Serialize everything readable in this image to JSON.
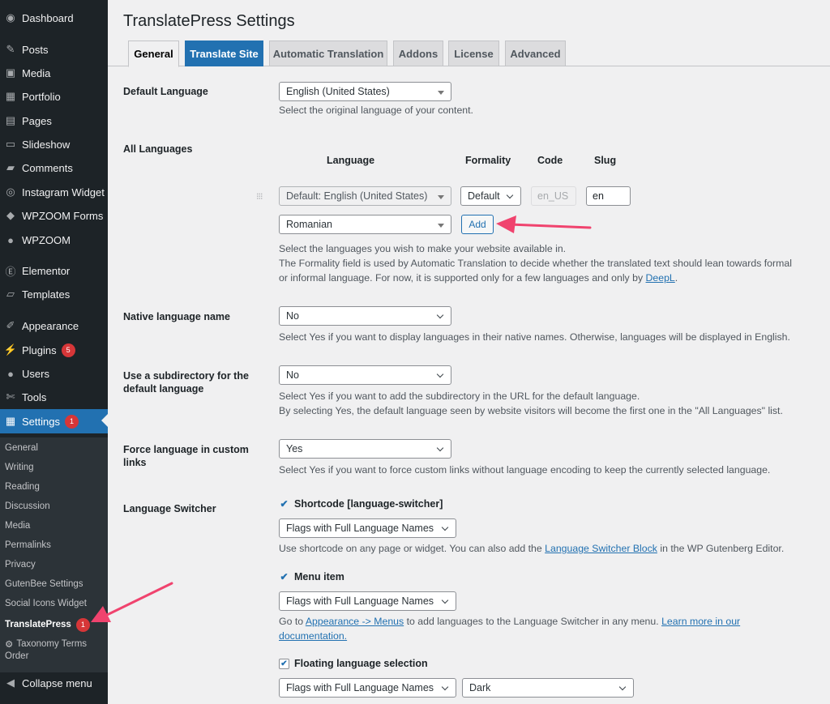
{
  "menu": {
    "dashboard": "Dashboard",
    "posts": "Posts",
    "media": "Media",
    "portfolio": "Portfolio",
    "pages": "Pages",
    "slideshow": "Slideshow",
    "comments": "Comments",
    "instagram": "Instagram Widget",
    "wpzoom_forms": "WPZOOM Forms",
    "wpzoom": "WPZOOM",
    "elementor": "Elementor",
    "templates": "Templates",
    "appearance": "Appearance",
    "plugins": "Plugins",
    "plugins_badge": "5",
    "users": "Users",
    "tools": "Tools",
    "settings": "Settings",
    "settings_badge": "1",
    "collapse": "Collapse menu"
  },
  "submenu": {
    "general": "General",
    "writing": "Writing",
    "reading": "Reading",
    "discussion": "Discussion",
    "media": "Media",
    "permalinks": "Permalinks",
    "privacy": "Privacy",
    "gutenbee": "GutenBee Settings",
    "social": "Social Icons Widget",
    "translatepress": "TranslatePress",
    "translatepress_badge": "1",
    "taxonomy1": "Taxonomy Terms",
    "taxonomy2": "Order"
  },
  "page_title": "TranslatePress Settings",
  "tabs": {
    "general": "General",
    "translate_site": "Translate Site",
    "automatic": "Automatic Translation",
    "addons": "Addons",
    "license": "License",
    "advanced": "Advanced"
  },
  "default_language": {
    "label": "Default Language",
    "value": "English (United States)",
    "desc": "Select the original language of your content."
  },
  "all_languages": {
    "label": "All Languages",
    "col_language": "Language",
    "col_formality": "Formality",
    "col_code": "Code",
    "col_slug": "Slug",
    "default_row": "Default: English (United States)",
    "formality": "Default",
    "code": "en_US",
    "slug": "en",
    "new_language": "Romanian",
    "add_button": "Add",
    "desc1": "Select the languages you wish to make your website available in.",
    "desc2": "The Formality field is used by Automatic Translation to decide whether the translated text should lean towards formal",
    "desc3_pre": "or informal language. For now, it is supported only for a few languages and only by ",
    "desc3_link": "DeepL",
    "desc3_post": "."
  },
  "native_name": {
    "label": "Native language name",
    "value": "No",
    "desc": "Select Yes if you want to display languages in their native names. Otherwise, languages will be displayed in English."
  },
  "subdirectory": {
    "label1": "Use a subdirectory for the",
    "label2": "default language",
    "value": "No",
    "desc1": "Select Yes if you want to add the subdirectory in the URL for the default language.",
    "desc2": "By selecting Yes, the default language seen by website visitors will become the first one in the \"All Languages\" list."
  },
  "force_language": {
    "label1": "Force language in custom",
    "label2": "links",
    "value": "Yes",
    "desc": "Select Yes if you want to force custom links without language encoding to keep the currently selected language."
  },
  "switcher": {
    "label": "Language Switcher",
    "shortcode_label": "Shortcode [language-switcher]",
    "shortcode_value": "Flags with Full Language Names",
    "shortcode_desc_pre": "Use shortcode on any page or widget. You can also add the ",
    "shortcode_desc_link": "Language Switcher Block",
    "shortcode_desc_post": " in the WP Gutenberg Editor.",
    "menu_label": "Menu item",
    "menu_value": "Flags with Full Language Names",
    "menu_desc_pre": "Go to ",
    "menu_desc_link1": "Appearance -> Menus",
    "menu_desc_mid": " to add languages to the Language Switcher in any menu. ",
    "menu_desc_link2a": "Learn more in our",
    "menu_desc_link2b": "documentation.",
    "floating_label": "Floating language selection",
    "floating_value": "Flags with Full Language Names",
    "floating_theme": "Dark"
  },
  "colors": {
    "accent": "#2271b1",
    "arrow": "#f0436e",
    "sidebar": "#1d2327"
  }
}
